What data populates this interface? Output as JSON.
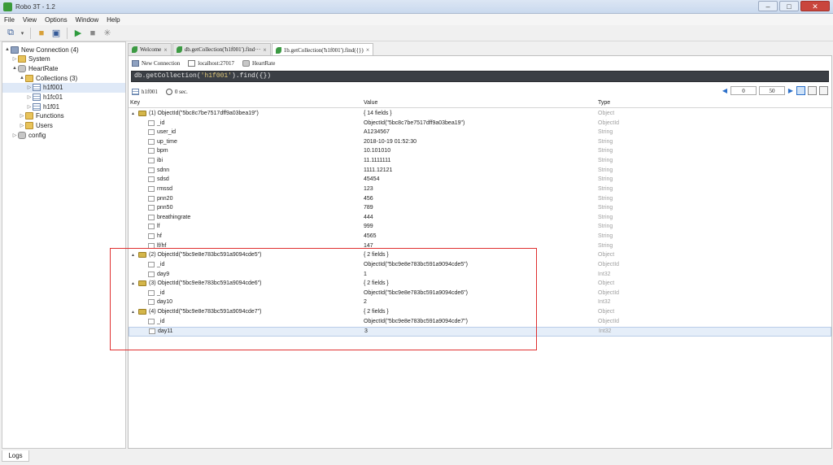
{
  "window": {
    "title": "Robo 3T - 1.2"
  },
  "menu": [
    "File",
    "View",
    "Options",
    "Window",
    "Help"
  ],
  "sidebar": {
    "tree": [
      {
        "label": "New Connection (4)",
        "level": 0,
        "arrow": "▲",
        "icon": "server-icon"
      },
      {
        "label": "System",
        "level": 1,
        "arrow": "▷",
        "icon": "folder-icon"
      },
      {
        "label": "HeartRate",
        "level": 1,
        "arrow": "▲",
        "icon": "database-icon"
      },
      {
        "label": "Collections (3)",
        "level": 2,
        "arrow": "▲",
        "icon": "folder-icon"
      },
      {
        "label": "h1f001",
        "level": 3,
        "arrow": "▷",
        "icon": "collection-icon"
      },
      {
        "label": "h1fc01",
        "level": 3,
        "arrow": "▷",
        "icon": "collection-icon"
      },
      {
        "label": "h1f01",
        "level": 3,
        "arrow": "▷",
        "icon": "collection-icon"
      },
      {
        "label": "Functions",
        "level": 2,
        "arrow": "▷",
        "icon": "folder-icon"
      },
      {
        "label": "Users",
        "level": 2,
        "arrow": "▷",
        "icon": "folder-icon"
      },
      {
        "label": "config",
        "level": 1,
        "arrow": "▷",
        "icon": "database-icon"
      }
    ]
  },
  "logs_tab": "Logs",
  "tabs": [
    {
      "label": "Welcome",
      "close": "×"
    },
    {
      "label": "db.getCollection('h1f001').find···",
      "close": "×"
    },
    {
      "label": "1b.getCollection('h1f001').find({})",
      "close": "×"
    }
  ],
  "connection_bar": {
    "connection": "New Connection",
    "host": "localhost:27017",
    "database": "HeartRate"
  },
  "query": {
    "prefix": "db.getCollection(",
    "collection": "'h1f001'",
    "suffix": ").find({})"
  },
  "result_bar": {
    "collection": "h1f001",
    "time": "0 sec.",
    "skip": "0",
    "limit": "50"
  },
  "columns": {
    "key": "Key",
    "value": "Value",
    "type": "Type"
  },
  "rows": [
    {
      "kind": "doc",
      "key": "(1) ObjectId(\"5bc8c7be7517dff9a03bea19\")",
      "value": "{ 14 fields }",
      "type": "Object"
    },
    {
      "kind": "field",
      "key": "_id",
      "value": "ObjectId(\"5bc8c7be7517dff9a03bea19\")",
      "type": "ObjectId"
    },
    {
      "kind": "field",
      "key": "user_id",
      "value": "A1234567",
      "type": "String"
    },
    {
      "kind": "field",
      "key": "up_time",
      "value": "2018-10-19 01:52:30",
      "type": "String"
    },
    {
      "kind": "field",
      "key": "bpm",
      "value": "10.101010",
      "type": "String"
    },
    {
      "kind": "field",
      "key": "ibi",
      "value": "11.1111111",
      "type": "String"
    },
    {
      "kind": "field",
      "key": "sdnn",
      "value": "1111.12121",
      "type": "String"
    },
    {
      "kind": "field",
      "key": "sdsd",
      "value": "45454",
      "type": "String"
    },
    {
      "kind": "field",
      "key": "rmssd",
      "value": "123",
      "type": "String"
    },
    {
      "kind": "field",
      "key": "pnn20",
      "value": "456",
      "type": "String"
    },
    {
      "kind": "field",
      "key": "pnn50",
      "value": "789",
      "type": "String"
    },
    {
      "kind": "field",
      "key": "breathingrate",
      "value": "444",
      "type": "String"
    },
    {
      "kind": "field",
      "key": "lf",
      "value": "999",
      "type": "String"
    },
    {
      "kind": "field",
      "key": "hf",
      "value": "4565",
      "type": "String"
    },
    {
      "kind": "field",
      "key": "lf/hf",
      "value": "147",
      "type": "String"
    },
    {
      "kind": "doc",
      "key": "(2) ObjectId(\"5bc9e8e783bc591a9094cde5\")",
      "value": "{ 2 fields }",
      "type": "Object"
    },
    {
      "kind": "field",
      "key": "_id",
      "value": "ObjectId(\"5bc9e8e783bc591a9094cde5\")",
      "type": "ObjectId"
    },
    {
      "kind": "field",
      "key": "day9",
      "value": "1",
      "type": "Int32"
    },
    {
      "kind": "doc",
      "key": "(3) ObjectId(\"5bc9e8e783bc591a9094cde6\")",
      "value": "{ 2 fields }",
      "type": "Object"
    },
    {
      "kind": "field",
      "key": "_id",
      "value": "ObjectId(\"5bc9e8e783bc591a9094cde6\")",
      "type": "ObjectId"
    },
    {
      "kind": "field",
      "key": "day10",
      "value": "2",
      "type": "Int32"
    },
    {
      "kind": "doc",
      "key": "(4) ObjectId(\"5bc9e8e783bc591a9094cde7\")",
      "value": "{ 2 fields }",
      "type": "Object"
    },
    {
      "kind": "field",
      "key": "_id",
      "value": "ObjectId(\"5bc9e8e783bc591a9094cde7\")",
      "type": "ObjectId"
    },
    {
      "kind": "field",
      "key": "day11",
      "value": "3",
      "type": "Int32",
      "selected": true
    }
  ]
}
